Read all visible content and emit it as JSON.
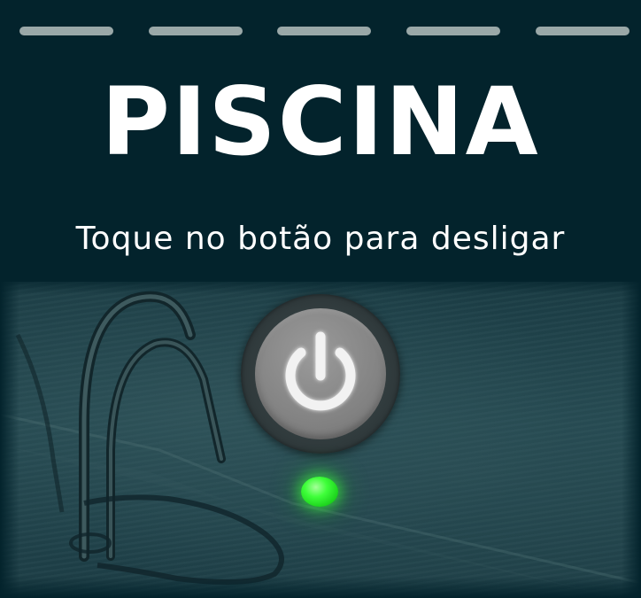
{
  "header": {
    "title": "PISCINA",
    "subtitle": "Toque no botão para desligar"
  },
  "controls": {
    "power_button_icon": "power-icon",
    "status_led_icon": "status-led",
    "status_led_color": "#3fff3a"
  },
  "colors": {
    "background": "#03232c",
    "text": "#ffffff",
    "dash": "#9aa8a8",
    "button_face": "#858585"
  }
}
